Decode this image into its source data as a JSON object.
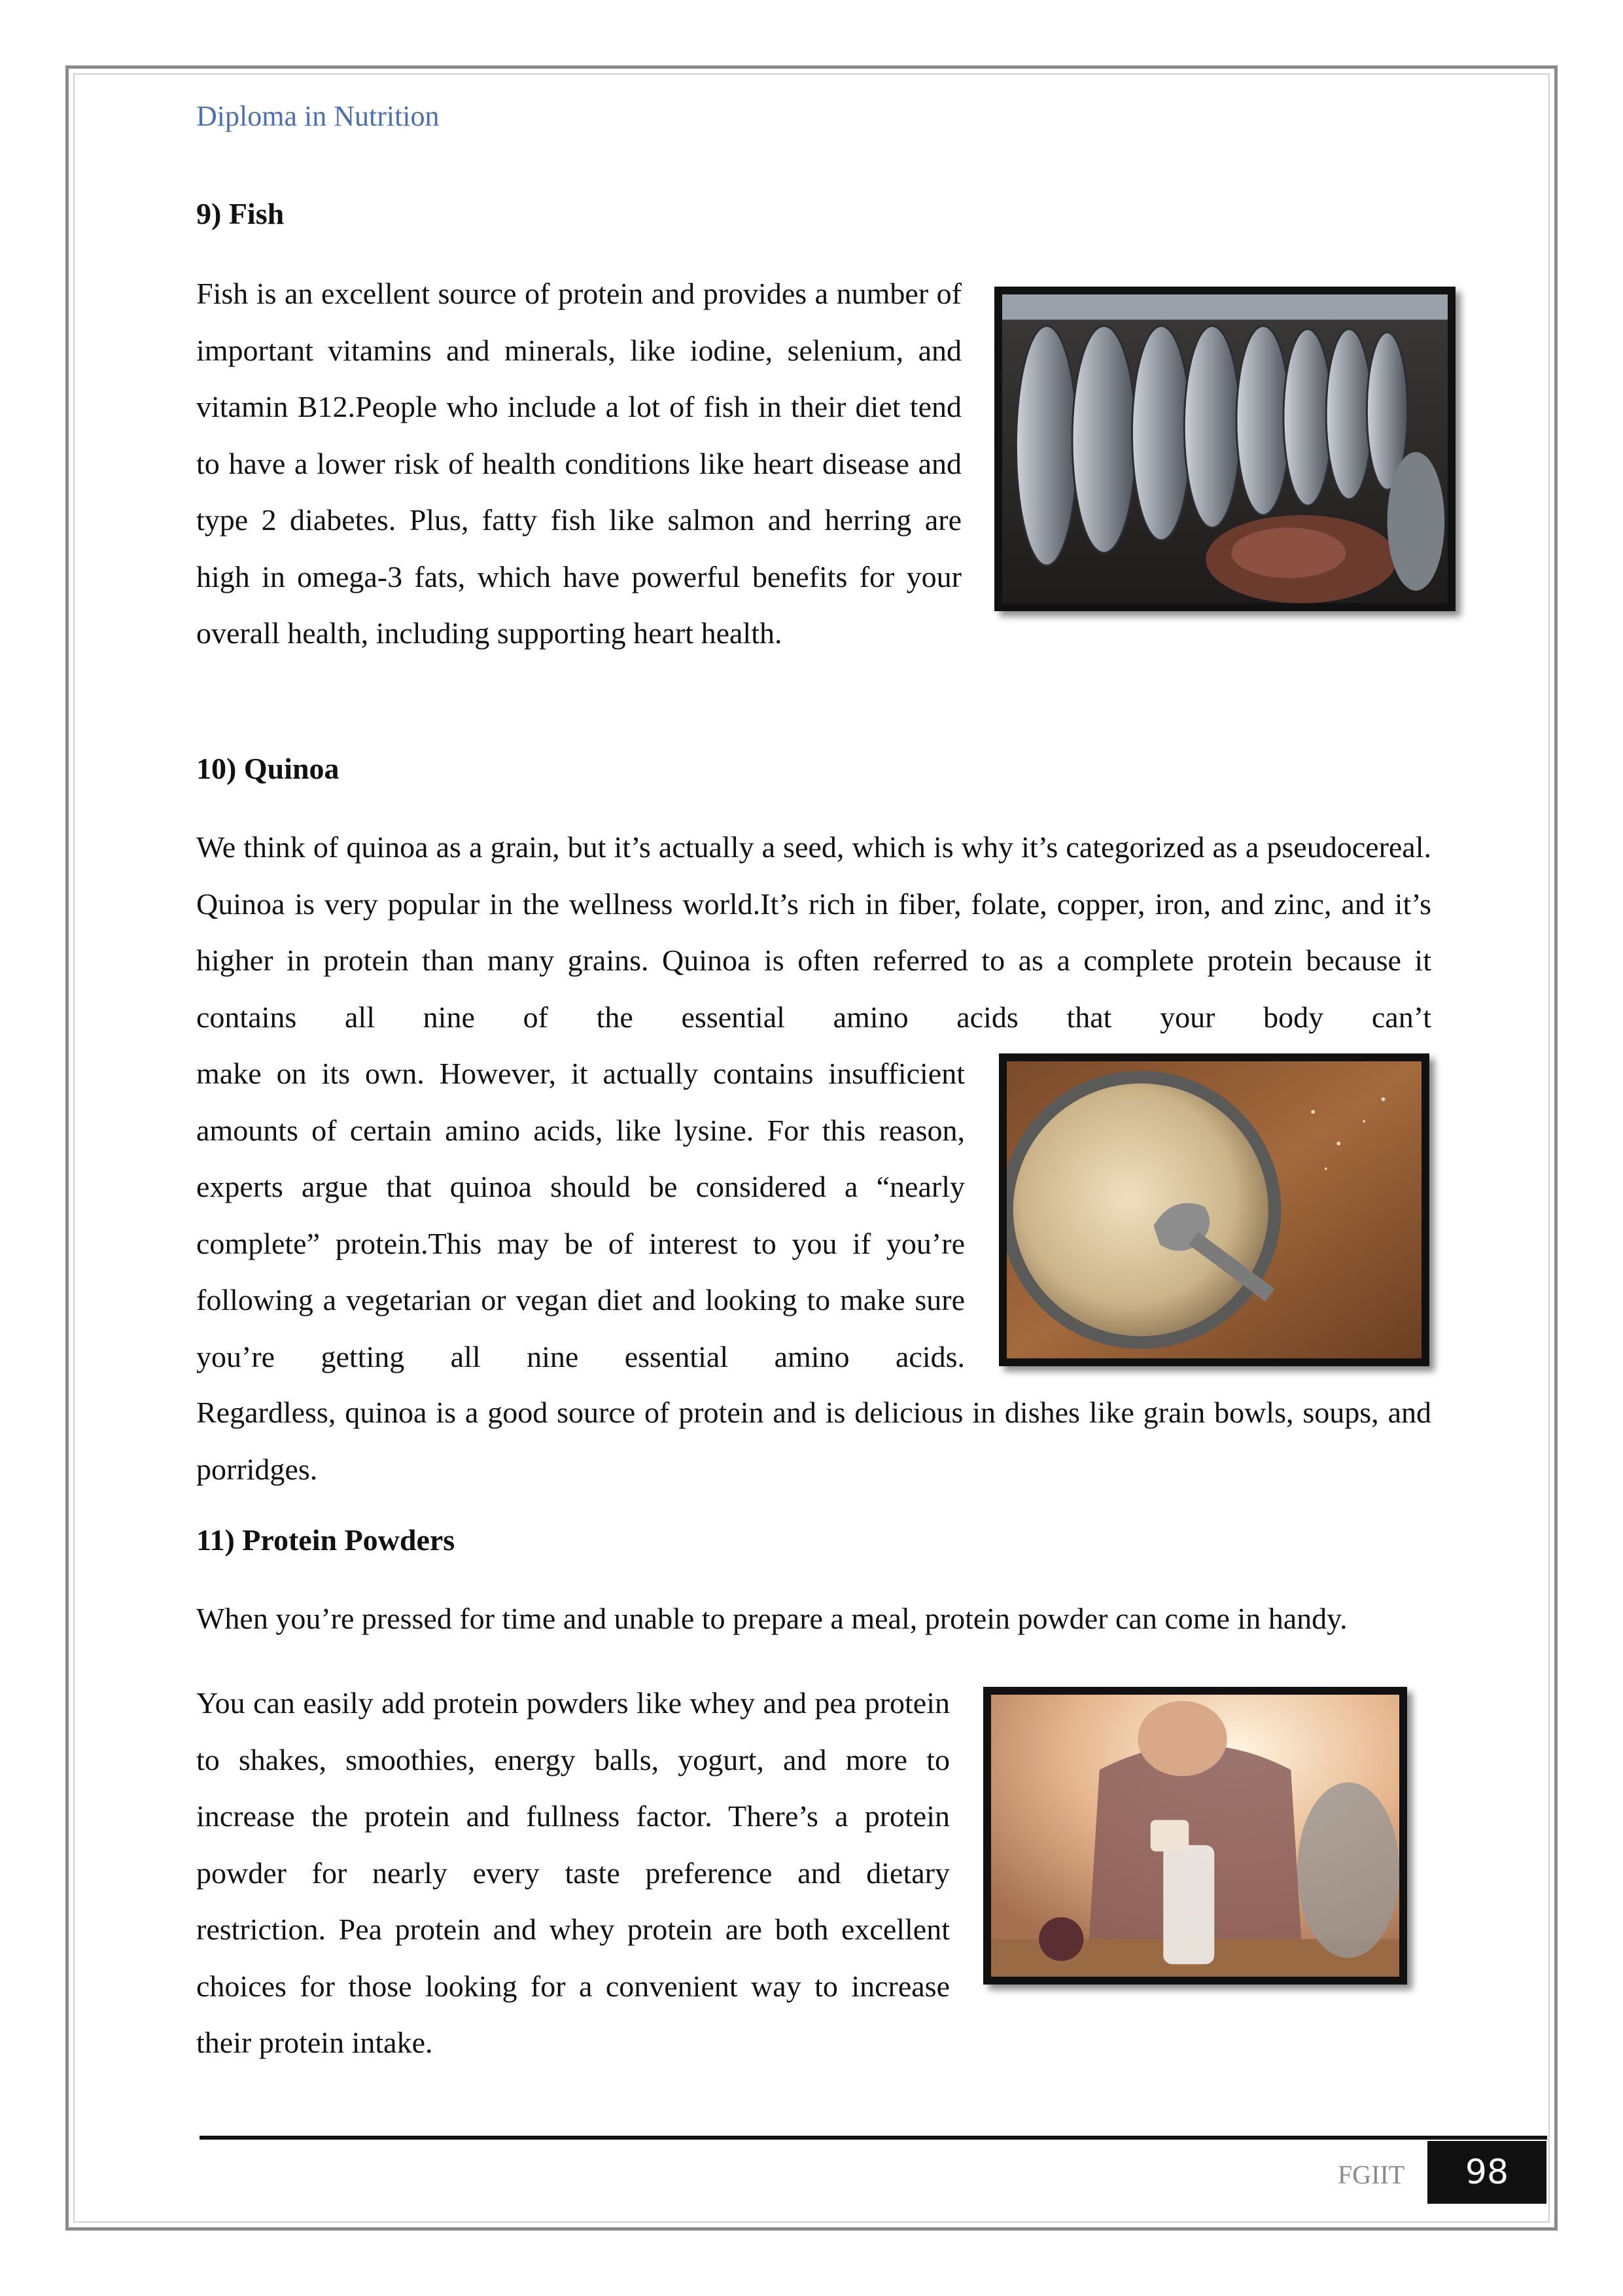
{
  "header": {
    "title": "Diploma in Nutrition"
  },
  "sections": [
    {
      "heading": "9) Fish",
      "paragraphs": [
        "Fish is an excellent source of protein and provides a number of important vitamins and minerals, like iodine, selenium, and vitamin B12.People who include a lot of fish in their diet tend to have a lower risk of health conditions like heart disease and type 2 diabetes. Plus, fatty fish like salmon and herring are high in omega-3 fats, which have powerful benefits for your overall health, including supporting heart health."
      ]
    },
    {
      "heading": "10) Quinoa",
      "paragraphs": [
        "We think of quinoa as a grain, but it’s actually a seed, which is why it’s categorized as a pseudocereal. Quinoa is very popular in the wellness world.It’s rich in fiber, folate, copper, iron, and zinc, and it’s higher in protein than many grains. Quinoa is often referred to as a complete protein because it contains all nine of the essential amino acids that your body can’t",
        "make on its own. However, it actually contains insufficient amounts of certain amino acids, like lysine. For this reason, experts argue that quinoa should be considered a “nearly complete” protein.This may be of interest to you if you’re following a vegetarian or vegan diet and looking to make sure you’re getting all nine essential amino acids.",
        "Regardless, quinoa is a good source of protein and is delicious in dishes like grain bowls, soups, and porridges."
      ]
    },
    {
      "heading": "11) Protein Powders",
      "paragraphs": [
        "When you’re pressed for time and unable to prepare a meal, protein powder can come in handy.",
        "You can easily add protein powders like whey and pea protein to shakes, smoothies, energy balls, yogurt, and more to increase the protein and fullness factor. There’s a protein powder for nearly every taste preference and dietary restriction. Pea protein and whey protein are both excellent choices for those looking for a convenient way to increase their protein intake."
      ]
    }
  ],
  "images": [
    "fish-photo",
    "quinoa-photo",
    "protein-shaker-photo"
  ],
  "footer": {
    "org": "FGIIT",
    "page_number": "98"
  }
}
